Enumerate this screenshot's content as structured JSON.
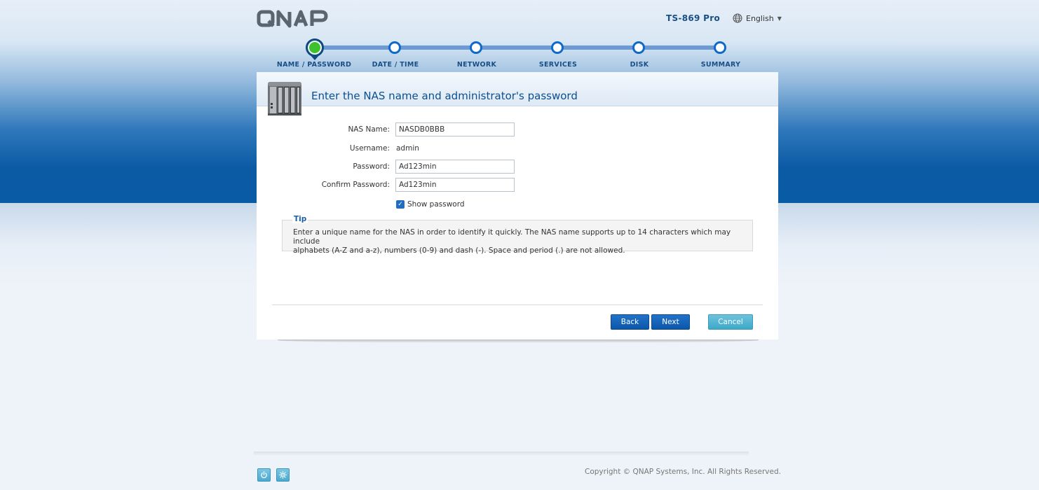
{
  "header": {
    "brand": "QNAP",
    "model": "TS-869 Pro",
    "language": "English"
  },
  "steps": [
    {
      "label": "NAME / PASSWORD",
      "state": "active"
    },
    {
      "label": "DATE / TIME",
      "state": "pending"
    },
    {
      "label": "NETWORK",
      "state": "pending"
    },
    {
      "label": "SERVICES",
      "state": "pending"
    },
    {
      "label": "DISK",
      "state": "pending"
    },
    {
      "label": "SUMMARY",
      "state": "pending"
    }
  ],
  "panel": {
    "title": "Enter the NAS name and administrator's password"
  },
  "form": {
    "nas_name_label": "NAS Name:",
    "nas_name_value": "NASDB0BBB",
    "username_label": "Username:",
    "username_value": "admin",
    "password_label": "Password:",
    "password_value": "Ad123min",
    "confirm_label": "Confirm Password:",
    "confirm_value": "Ad123min",
    "show_password_label": "Show password",
    "show_password_checked": true
  },
  "tip": {
    "title": "Tip",
    "line1": "Enter a unique name for the NAS in order to identify it quickly. The NAS name supports up to 14 characters which may include",
    "line2": "alphabets (A-Z and a-z), numbers (0-9) and dash (-). Space and period (.) are not allowed."
  },
  "buttons": {
    "back": "Back",
    "next": "Next",
    "cancel": "Cancel"
  },
  "footer": {
    "copyright": "Copyright © QNAP Systems, Inc. All Rights Reserved."
  },
  "colors": {
    "accent": "#0b56a9",
    "active_step": "#3ec12f",
    "cancel": "#3ea8c9"
  }
}
